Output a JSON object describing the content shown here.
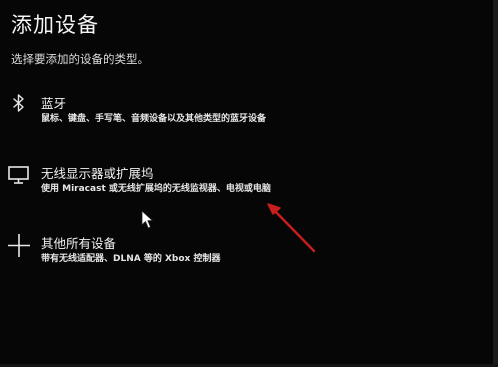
{
  "dialog": {
    "title": "添加设备",
    "subtitle": "选择要添加的设备的类型。"
  },
  "items": [
    {
      "icon": "bluetooth-icon",
      "label": "蓝牙",
      "description": "鼠标、键盘、手写笔、音频设备以及其他类型的蓝牙设备"
    },
    {
      "icon": "monitor-icon",
      "label": "无线显示器或扩展坞",
      "description": "使用 Miracast 或无线扩展坞的无线监视器、电视或电脑"
    },
    {
      "icon": "plus-icon",
      "label": "其他所有设备",
      "description": "带有无线适配器、DLNA 等的 Xbox 控制器"
    }
  ],
  "colors": {
    "background": "#060606",
    "text": "#f2f2f2",
    "annotation_arrow": "#c81e1e"
  }
}
